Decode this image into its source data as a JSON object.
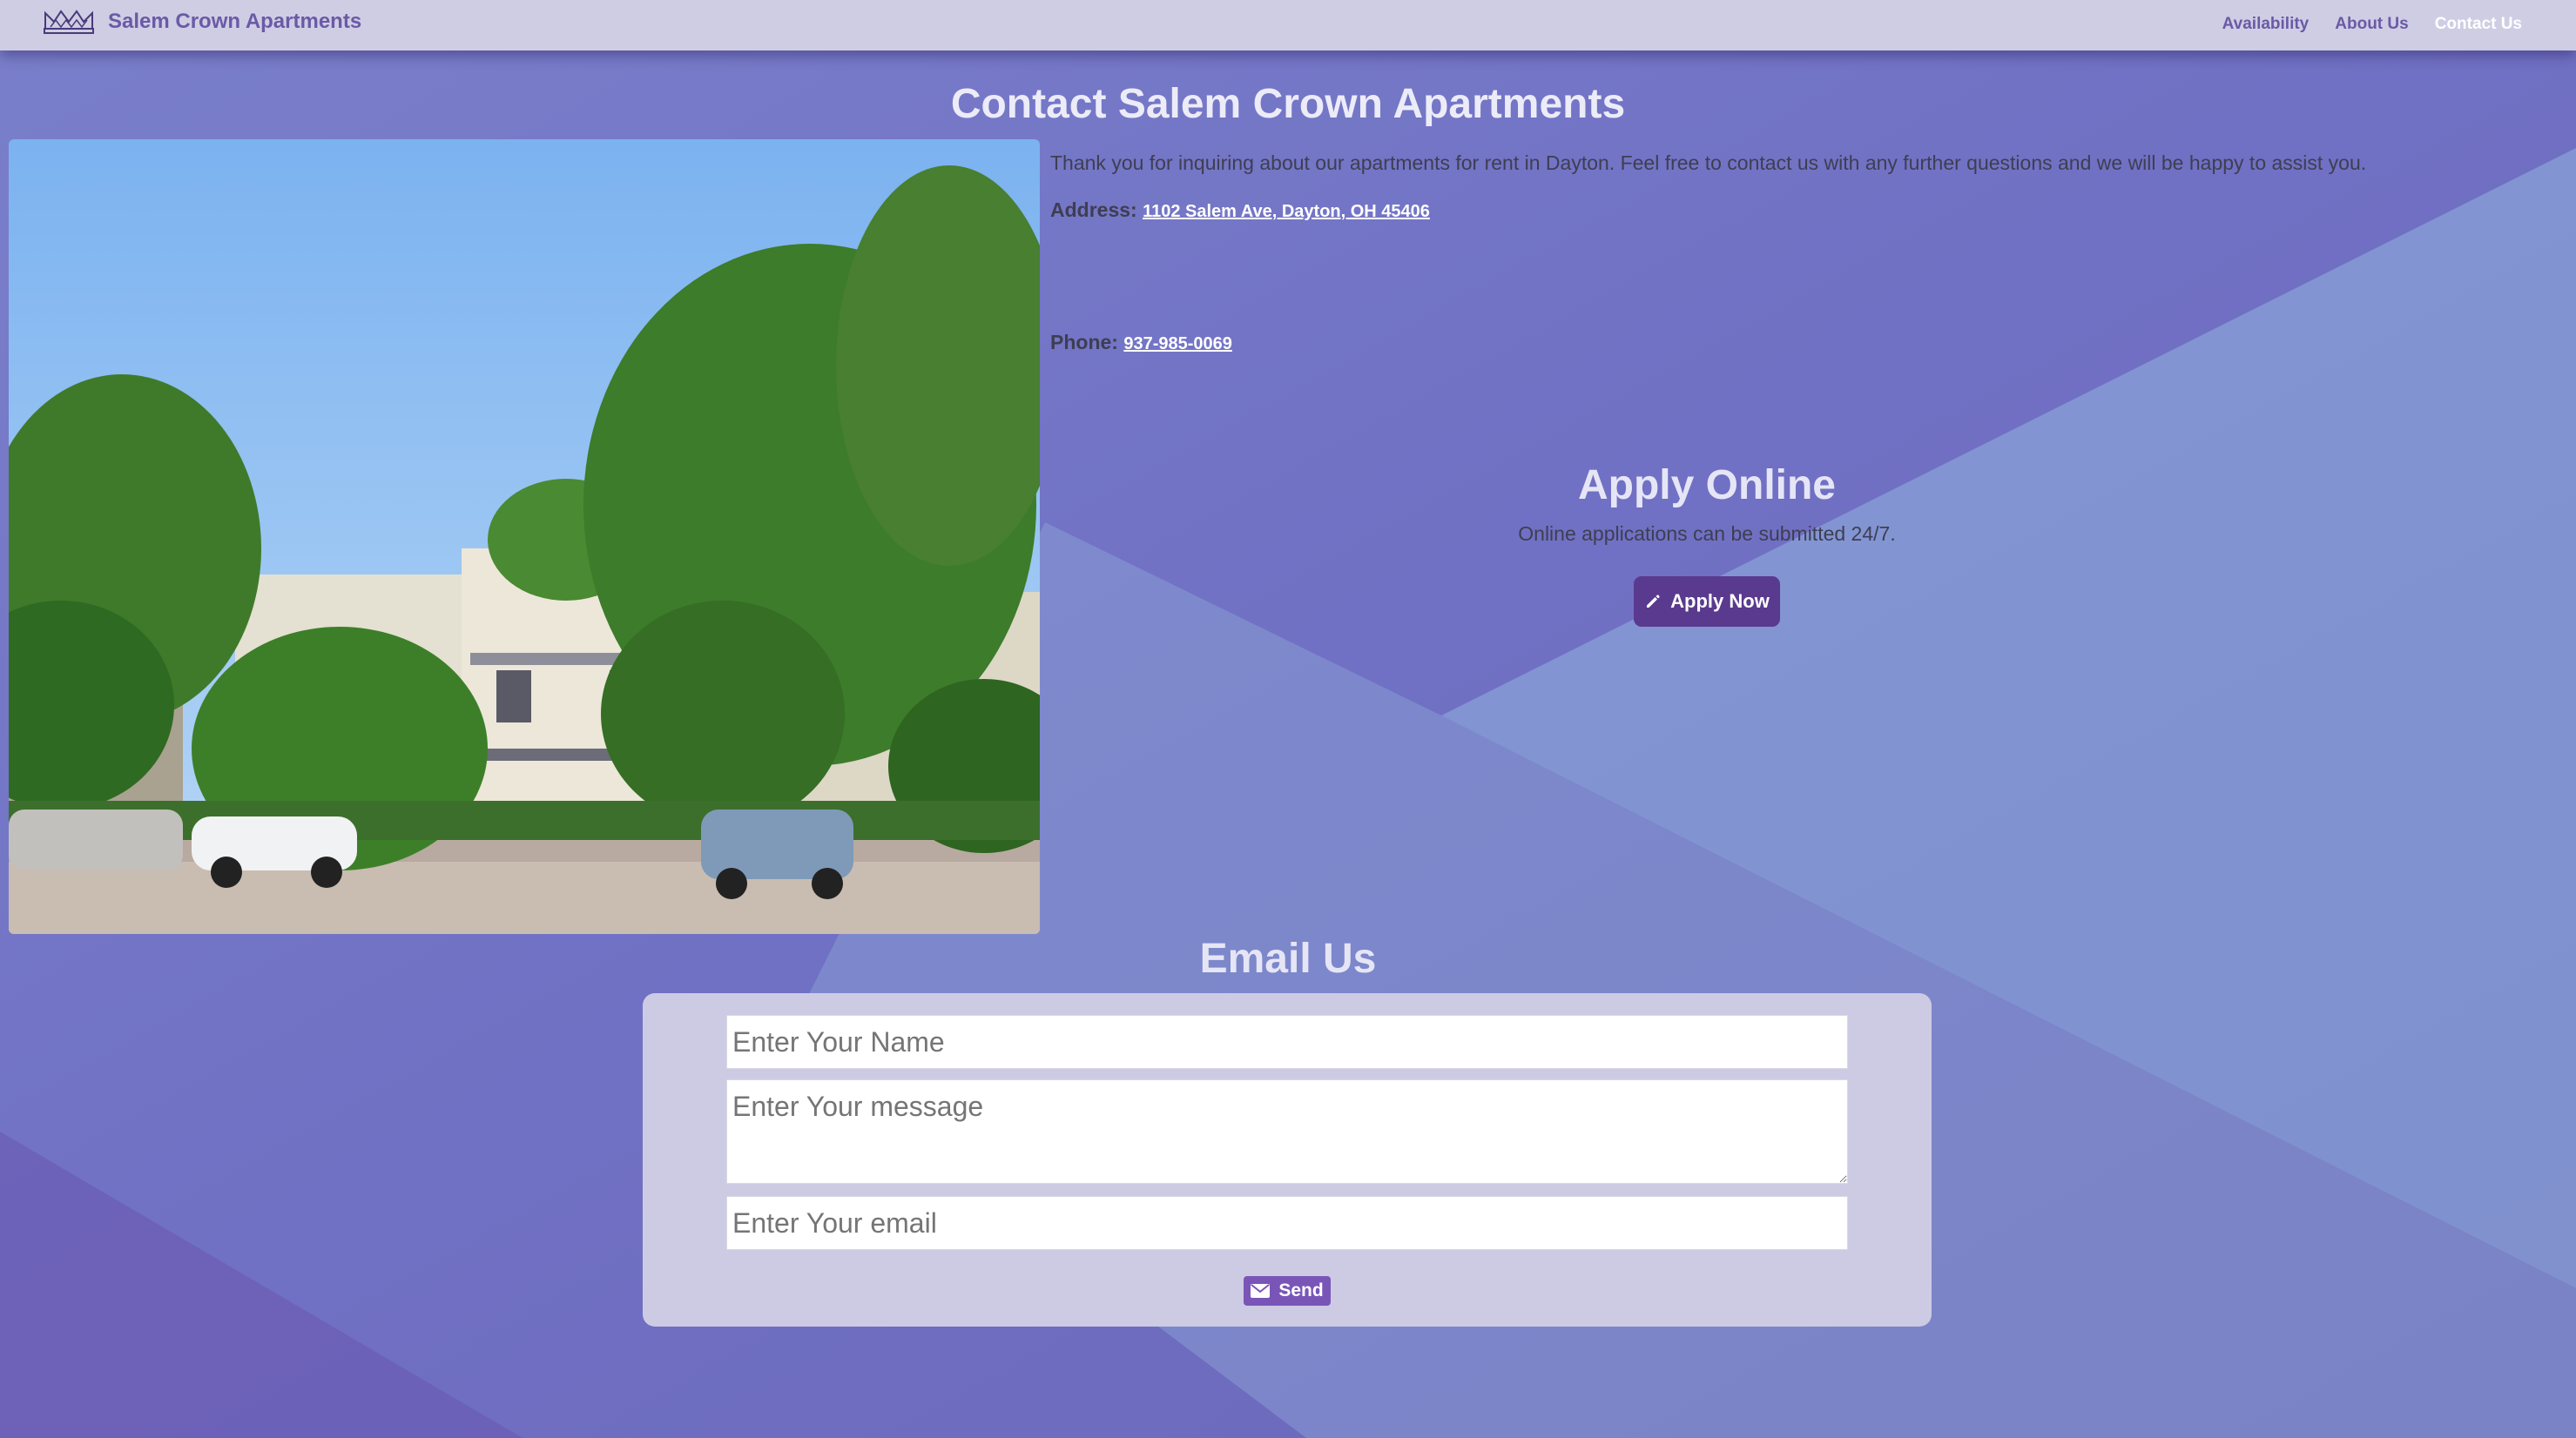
{
  "navbar": {
    "brand": "Salem Crown Apartments",
    "logo_icon": "crown-logo-icon",
    "links": [
      {
        "label": "Availability",
        "active": false
      },
      {
        "label": "About Us",
        "active": false
      },
      {
        "label": "Contact Us",
        "active": true
      }
    ]
  },
  "page": {
    "title": "Contact Salem Crown Apartments",
    "intro": "Thank you for inquiring about our apartments for rent in Dayton. Feel free to contact us with any further questions and we will be happy to assist you.",
    "address_label": "Address:",
    "address_value": "1102 Salem Ave, Dayton, OH 45406",
    "phone_label": "Phone:",
    "phone_value": "937-985-0069"
  },
  "apply": {
    "title": "Apply Online",
    "subtitle": "Online applications can be submitted 24/7.",
    "button_label": "Apply Now",
    "button_icon": "pencil-icon"
  },
  "email": {
    "title": "Email Us",
    "name_placeholder": "Enter Your Name",
    "message_placeholder": "Enter Your message",
    "email_placeholder": "Enter Your email",
    "send_label": "Send",
    "send_icon": "envelope-icon"
  },
  "colors": {
    "navbar_bg": "#cfcde4",
    "accent": "#5a3a8e",
    "background": "#6f6bbf"
  }
}
